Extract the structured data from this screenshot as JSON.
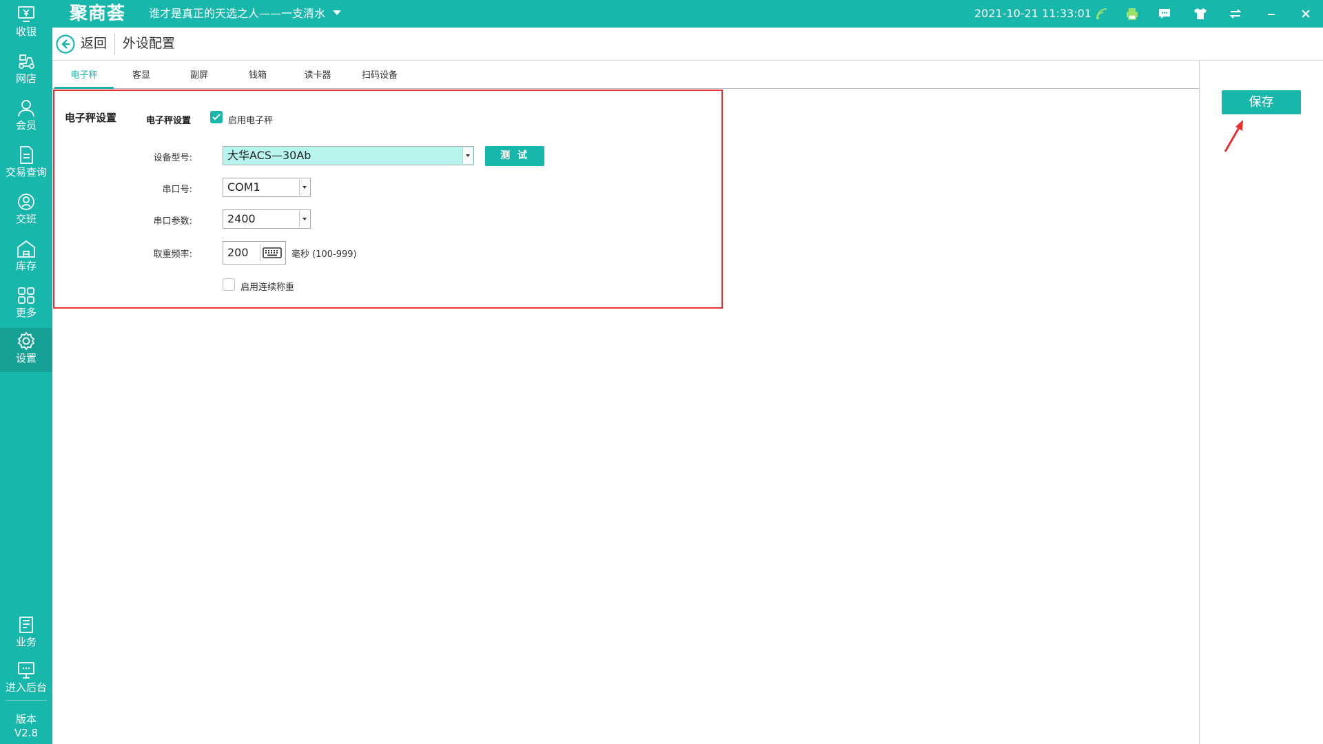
{
  "titlebar": {
    "logo": "聚商荟",
    "shop_name": "谁才是真正的天选之人——一支清水",
    "datetime": "2021-10-21 11:33:01"
  },
  "sidebar": {
    "items": [
      {
        "label": "收银"
      },
      {
        "label": "网店"
      },
      {
        "label": "会员"
      },
      {
        "label": "交易查询"
      },
      {
        "label": "交班"
      },
      {
        "label": "库存"
      },
      {
        "label": "更多"
      },
      {
        "label": "设置"
      },
      {
        "label": "业务"
      },
      {
        "label": "进入后台"
      }
    ],
    "version_label": "版本",
    "version": "V2.8"
  },
  "header": {
    "back_label": "返回",
    "title": "外设配置"
  },
  "tabs": [
    {
      "label": "电子秤"
    },
    {
      "label": "客显"
    },
    {
      "label": "副屏"
    },
    {
      "label": "钱箱"
    },
    {
      "label": "读卡器"
    },
    {
      "label": "扫码设备"
    }
  ],
  "save_label": "保存",
  "scale_settings": {
    "section_title": "电子秤设置",
    "group_title": "电子秤设置",
    "enable_label": "启用电子秤",
    "enable_checked": true,
    "device_model_label": "设备型号:",
    "device_model_value": "大华ACS—30Ab",
    "test_label": "测 试",
    "port_label": "串口号:",
    "port_value": "COM1",
    "port_params_label": "串口参数:",
    "port_params_value": "2400",
    "frequency_label": "取重频率:",
    "frequency_value": "200",
    "frequency_unit": "毫秒 (100-999)",
    "continuous_label": "启用连续称重",
    "continuous_checked": false
  },
  "colors": {
    "brand": "#18b7ac",
    "highlight_border": "#e8312e",
    "device_select_bg": "#b7f5ee"
  },
  "icons": {
    "titlebar": [
      "wifi-signal-icon",
      "printer-icon",
      "message-icon",
      "tshirt-icon",
      "switch-icon",
      "minimize-icon",
      "close-icon"
    ]
  }
}
